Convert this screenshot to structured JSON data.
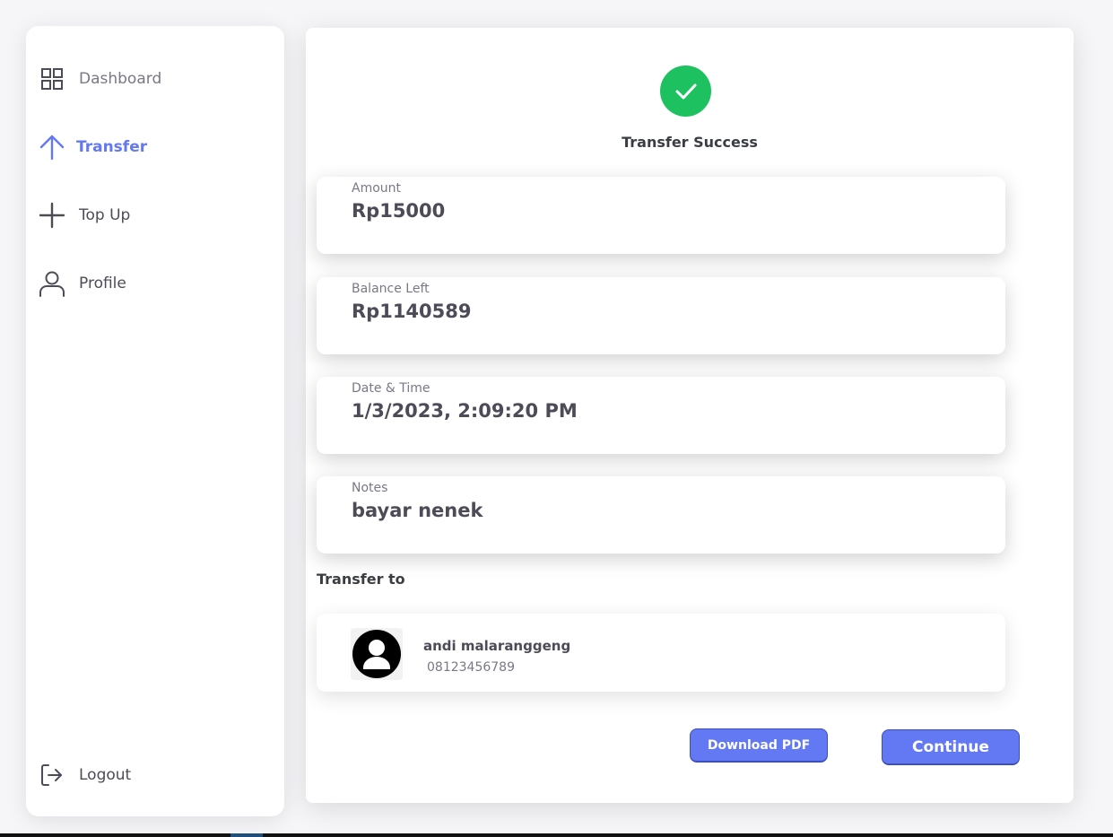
{
  "sidebar": {
    "items": [
      {
        "label": "Dashboard",
        "icon": "grid-icon"
      },
      {
        "label": "Transfer",
        "icon": "arrow-up-icon",
        "active": true
      },
      {
        "label": "Top Up",
        "icon": "plus-icon"
      },
      {
        "label": "Profile",
        "icon": "user-icon"
      }
    ],
    "logout": {
      "label": "Logout",
      "icon": "logout-icon"
    }
  },
  "colors": {
    "accent": "#6379f4",
    "success": "#1ec15f",
    "text_dark": "#4d4b57",
    "text_muted": "#7a7886"
  },
  "main": {
    "status": {
      "icon": "check-icon",
      "title": "Transfer Success"
    },
    "details": [
      {
        "label": "Amount",
        "value": "Rp15000"
      },
      {
        "label": "Balance Left",
        "value": "Rp1140589"
      },
      {
        "label": "Date & Time",
        "value": "1/3/2023, 2:09:20 PM"
      },
      {
        "label": "Notes",
        "value": "bayar nenek"
      }
    ],
    "transfer_to_label": "Transfer to",
    "recipient": {
      "avatar_icon": "user-avatar-icon",
      "name": "andi malaranggeng",
      "phone": "08123456789"
    },
    "buttons": {
      "download_pdf": "Download PDF",
      "continue": "Continue"
    }
  }
}
